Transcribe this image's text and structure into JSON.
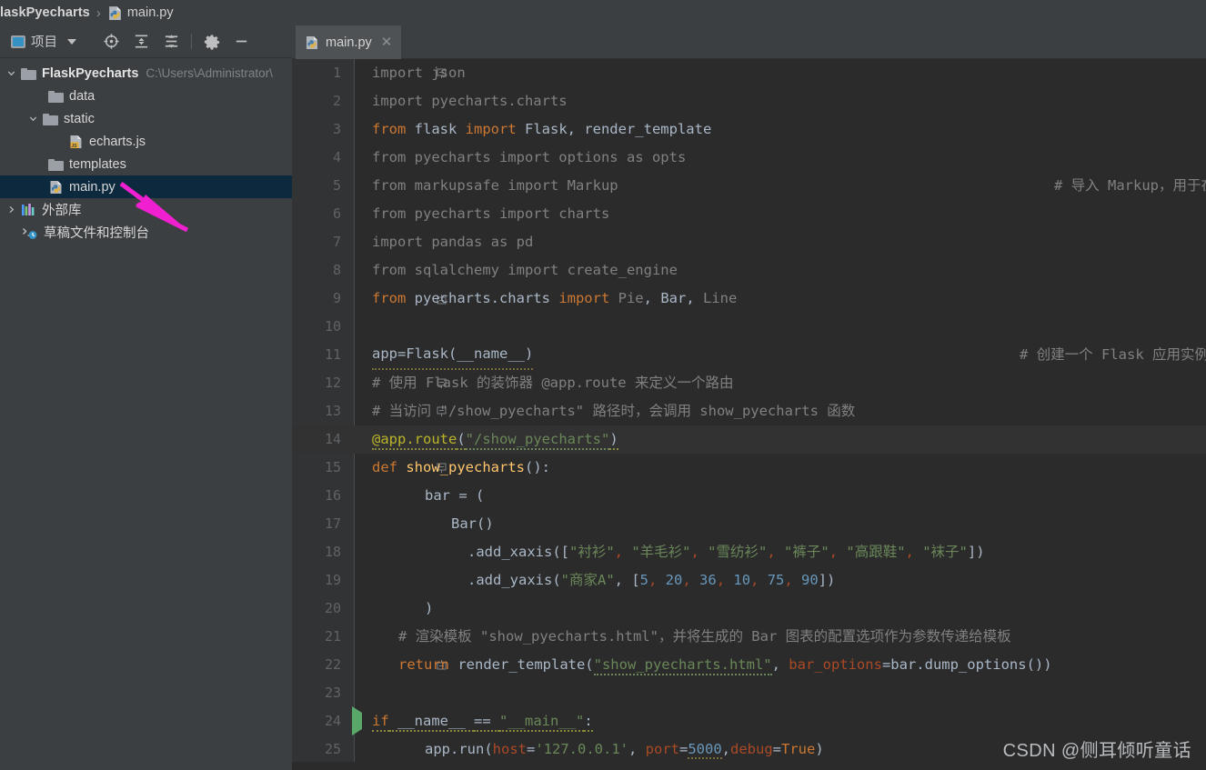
{
  "breadcrumb": {
    "project": "laskPyecharts",
    "separator": "›",
    "file": "main.py",
    "file_icon": "python-file-icon"
  },
  "project_toolbar": {
    "label": "项目",
    "dropdown_icon": "chevron-down-icon",
    "icons": [
      {
        "name": "locate-target-icon"
      },
      {
        "name": "expand-all-icon"
      },
      {
        "name": "collapse-all-icon"
      },
      {
        "name": "settings-gear-icon"
      },
      {
        "name": "minimize-icon"
      }
    ]
  },
  "tree": [
    {
      "label": "FlaskPyecharts",
      "path": "C:\\Users\\Administrator\\",
      "icon": "folder-icon",
      "twist": "chevron-down-icon",
      "indent": 0,
      "bold": true,
      "selected": false
    },
    {
      "label": "data",
      "path": "",
      "icon": "folder-icon",
      "twist": "",
      "indent": 1,
      "bold": false,
      "selected": false
    },
    {
      "label": "static",
      "path": "",
      "icon": "folder-icon",
      "twist": "chevron-down-icon",
      "indent": 1,
      "bold": false,
      "selected": false
    },
    {
      "label": "echarts.js",
      "path": "",
      "icon": "js-file-icon",
      "twist": "",
      "indent": 2,
      "bold": false,
      "selected": false
    },
    {
      "label": "templates",
      "path": "",
      "icon": "folder-icon",
      "twist": "",
      "indent": 1,
      "bold": false,
      "selected": false
    },
    {
      "label": "main.py",
      "path": "",
      "icon": "python-file-icon",
      "twist": "",
      "indent": 1,
      "bold": false,
      "selected": true
    },
    {
      "label": "外部库",
      "path": "",
      "icon": "external-libraries-icon",
      "twist": "chevron-right-icon",
      "indent": 0,
      "bold": false,
      "selected": false
    },
    {
      "label": "草稿文件和控制台",
      "path": "",
      "icon": "scratches-consoles-icon",
      "twist": "",
      "indent": 0,
      "bold": false,
      "selected": false
    }
  ],
  "editor_tab": {
    "title": "main.py",
    "icon": "python-file-icon",
    "close_icon": "close-icon"
  },
  "code": {
    "lines": [
      {
        "n": "1",
        "fold": "fold-collapse-start"
      },
      {
        "n": "2",
        "fold": ""
      },
      {
        "n": "3",
        "fold": ""
      },
      {
        "n": "4",
        "fold": ""
      },
      {
        "n": "5",
        "fold": ""
      },
      {
        "n": "6",
        "fold": ""
      },
      {
        "n": "7",
        "fold": ""
      },
      {
        "n": "8",
        "fold": ""
      },
      {
        "n": "9",
        "fold": "fold-collapse-end"
      },
      {
        "n": "10",
        "fold": ""
      },
      {
        "n": "11",
        "fold": ""
      },
      {
        "n": "12",
        "fold": "fold-collapse-start"
      },
      {
        "n": "13",
        "fold": "fold-collapse-start"
      },
      {
        "n": "14",
        "fold": ""
      },
      {
        "n": "15",
        "fold": "fold-collapse-start"
      },
      {
        "n": "16",
        "fold": ""
      },
      {
        "n": "17",
        "fold": ""
      },
      {
        "n": "18",
        "fold": ""
      },
      {
        "n": "19",
        "fold": ""
      },
      {
        "n": "20",
        "fold": ""
      },
      {
        "n": "21",
        "fold": ""
      },
      {
        "n": "22",
        "fold": "fold-collapse-end"
      },
      {
        "n": "23",
        "fold": ""
      },
      {
        "n": "24",
        "fold": "run-icon"
      },
      {
        "n": "25",
        "fold": ""
      }
    ],
    "text": {
      "l1": "import json",
      "l2": "import pyecharts.charts",
      "l3_kw1": "from",
      "l3_mod": " flask ",
      "l3_kw2": "import",
      "l3_rest": " Flask, render_template",
      "l4": "from pyecharts import options as opts",
      "l5": "from markupsafe import Markup",
      "l5_comment": "# 导入 Markup，用于在 Flask 模板中安全地渲染 HTML",
      "l6": "from pyecharts import charts",
      "l7": "import pandas as pd",
      "l8": "from sqlalchemy import create_engine",
      "l9_kw1": "from",
      "l9_mod": " pyecharts.charts ",
      "l9_kw2": "import",
      "l9_pie": " Pie",
      "l9_c1": ", ",
      "l9_bar": "Bar",
      "l9_c2": ", ",
      "l9_line": "Line",
      "l11_code": "app=Flask(__name__)",
      "l11_comment": "# 创建一个 Flask 应用实例",
      "l12": "# 使用 Flask 的装饰器 @app.route 来定义一个路由",
      "l13": "# 当访问 \"/show_pyecharts\" 路径时，会调用 show_pyecharts 函数",
      "l14_dec": "@app.route",
      "l14_p1": "(",
      "l14_str": "\"/show_pyecharts\"",
      "l14_p2": ")",
      "l15_kw": "def",
      "l15_fn": " show_pyecharts",
      "l15_rest": "():",
      "l16": "bar = (",
      "l17": "Bar()",
      "l18_call": ".add_xaxis([",
      "l18_s1": "\"衬衫\"",
      "l18_s2": "\"羊毛衫\"",
      "l18_s3": "\"雪纺衫\"",
      "l18_s4": "\"裤子\"",
      "l18_s5": "\"高跟鞋\"",
      "l18_s6": "\"袜子\"",
      "l18_end": "])",
      "l19_call": ".add_yaxis(",
      "l19_s1": "\"商家A\"",
      "l19_open": ", [",
      "l19_v1": "5",
      "l19_v2": "20",
      "l19_v3": "36",
      "l19_v4": "10",
      "l19_v5": "75",
      "l19_v6": "90",
      "l19_end": "])",
      "l20": ")",
      "l21": "# 渲染模板 \"show_pyecharts.html\"，并将生成的 Bar 图表的配置选项作为参数传递给模板",
      "l22_kw": "return",
      "l22_fn": " render_template(",
      "l22_str": "\"show_pyecharts.html\"",
      "l22_c": ", ",
      "l22_kwarg": "bar_options",
      "l22_eq": "=",
      "l22_rest": "bar.dump_options())",
      "l24_kw1": "if",
      "l24_name": " __name__ ",
      "l24_eq": "== ",
      "l24_str": "\"__main__\"",
      "l24_colon": ":",
      "l25_call": "app.run(",
      "l25_k1": "host",
      "l25_eq1": "=",
      "l25_v1": "'127.0.0.1'",
      "l25_c1": ", ",
      "l25_k2": "port",
      "l25_eq2": "=",
      "l25_v2": "5000",
      "l25_c2": ",",
      "l25_k3": "debug",
      "l25_eq3": "=",
      "l25_v3": "True",
      "l25_end": ")"
    }
  },
  "watermark": {
    "text": "CSDN @侧耳倾听童话"
  },
  "annotation": {
    "arrow": "pink-arrow-annotation",
    "color": "#f020d0"
  },
  "colors": {
    "editor_bg": "#2b2b2b",
    "gutter_bg": "#313335",
    "panel_bg": "#3c3f41",
    "selection_bg": "#0d293e",
    "tab_active_bg": "#4e5254",
    "keyword": "#cc7832",
    "string": "#6a8759",
    "number": "#6897bb",
    "comment": "#808080",
    "decorator": "#bbb529",
    "function": "#ffc66d",
    "kwarg": "#aa4926",
    "default_text": "#a9b7c6",
    "run_green": "#59a869"
  }
}
